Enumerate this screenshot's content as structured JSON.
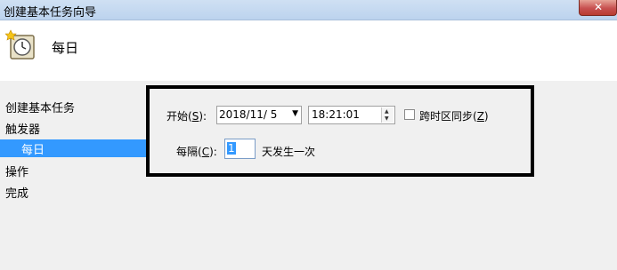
{
  "window": {
    "title": "创建基本任务向导",
    "close_glyph": "✕"
  },
  "header": {
    "title": "每日"
  },
  "sidebar": {
    "items": [
      {
        "label": "创建基本任务"
      },
      {
        "label": "触发器"
      },
      {
        "label": "每日",
        "selected": true
      },
      {
        "label": "操作"
      },
      {
        "label": "完成"
      }
    ]
  },
  "form": {
    "start": {
      "label": "开始(",
      "hotkey": "S",
      "label_end": "):",
      "date_value": "2018/11/  5",
      "time_value": "18:21:01"
    },
    "sync": {
      "label": "跨时区同步(",
      "hotkey": "Z",
      "label_end": ")",
      "checked": false
    },
    "recur": {
      "label": "每隔(",
      "hotkey": "C",
      "label_end": "):",
      "value": "1",
      "suffix": "天发生一次"
    }
  },
  "colors": {
    "selection": "#3399ff",
    "highlight_frame": "#000000"
  }
}
